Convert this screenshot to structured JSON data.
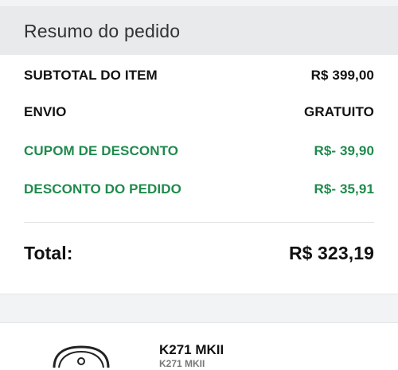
{
  "order_summary": {
    "title": "Resumo do pedido",
    "lines": [
      {
        "label": "SUBTOTAL DO ITEM",
        "value": "R$ 399,00"
      },
      {
        "label": "ENVIO",
        "value": "GRATUITO"
      },
      {
        "label": "CUPOM DE DESCONTO",
        "value": "R$- 39,90"
      },
      {
        "label": "DESCONTO DO PEDIDO",
        "value": "R$- 35,91"
      }
    ],
    "total_label": "Total:",
    "total_value": "R$ 323,19"
  },
  "product": {
    "name": "K271 MKII",
    "subtitle": "K271 MKII",
    "image_icon": "headphones-icon"
  },
  "colors": {
    "discount_green": "#1f8a4c",
    "header_bg": "#e8eaec"
  }
}
